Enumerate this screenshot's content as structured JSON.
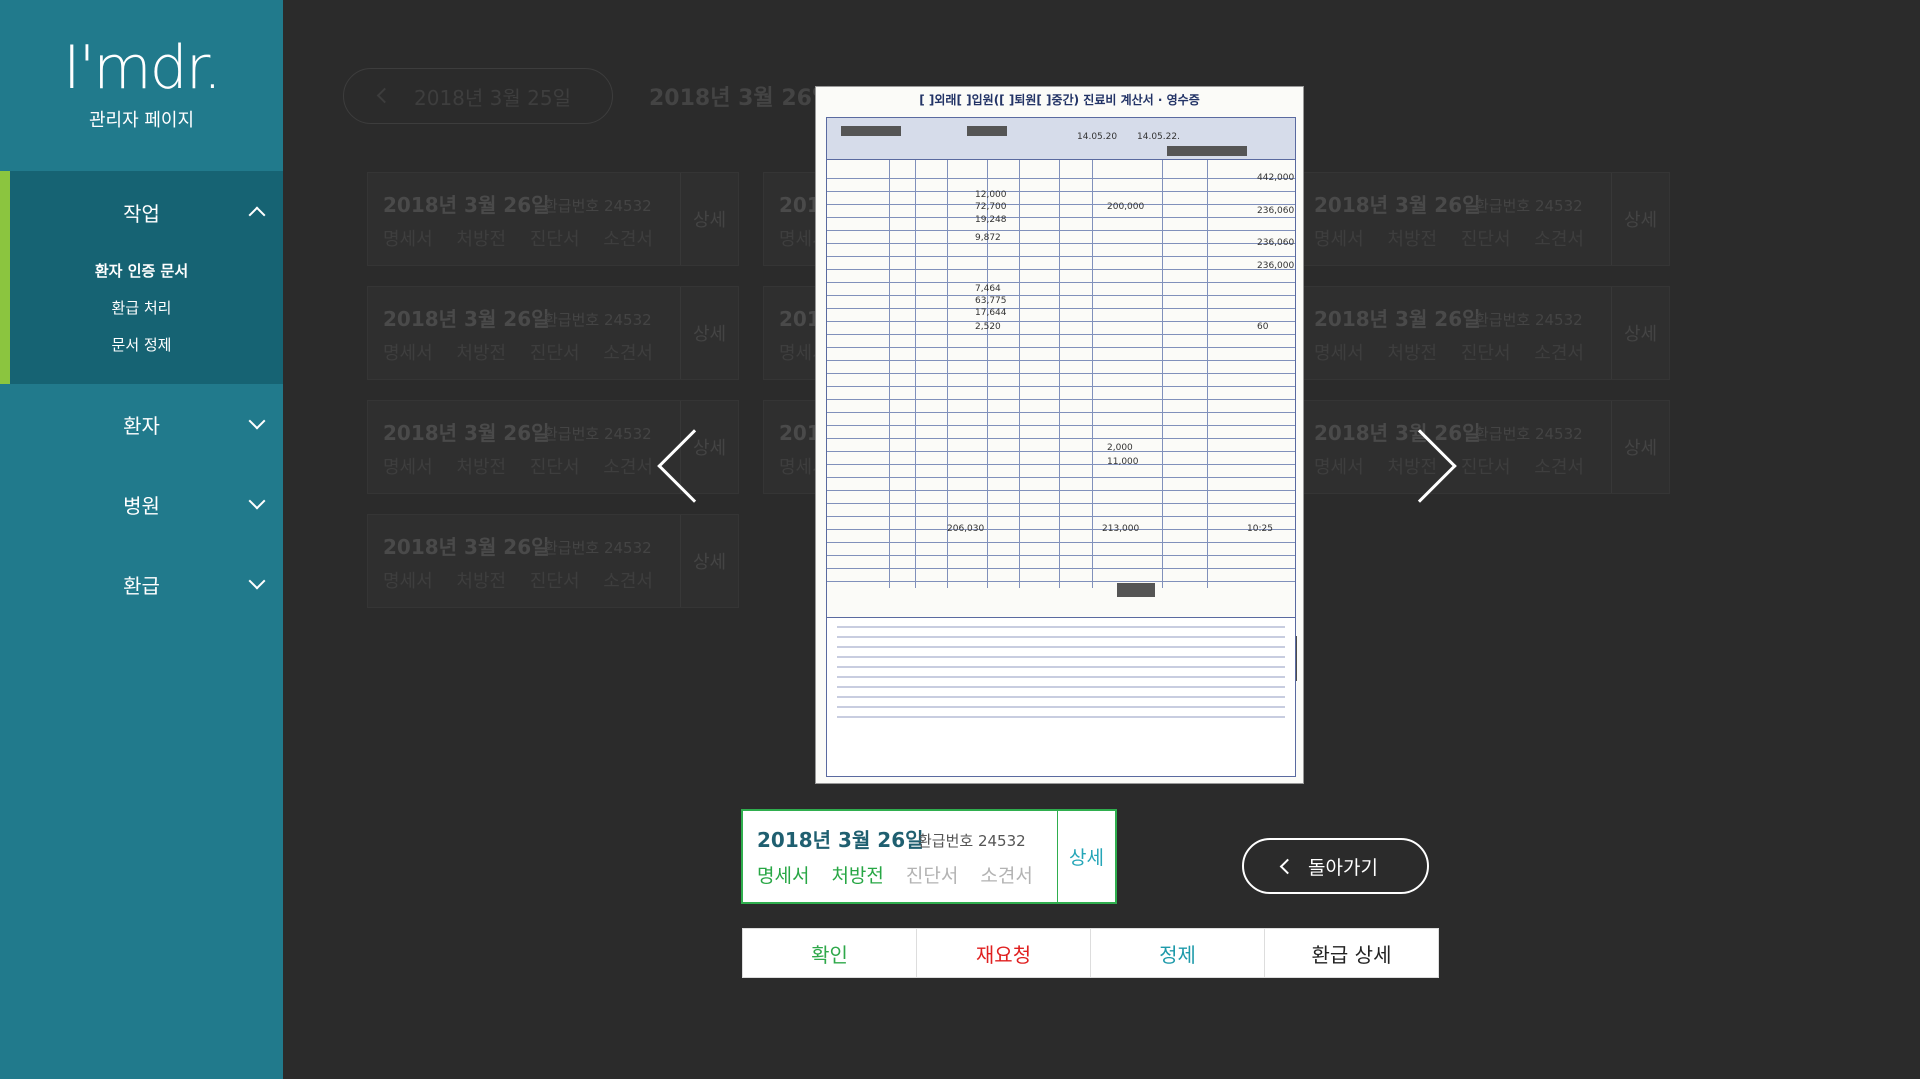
{
  "brand": {
    "logo": "I'mdr.",
    "subtitle": "관리자 페이지"
  },
  "sidebar": {
    "menus": [
      {
        "label": "작업",
        "expanded": true,
        "items": [
          "환자 인증 문서",
          "환급 처리",
          "문서 정제"
        ],
        "current": "환자 인증 문서"
      },
      {
        "label": "환자",
        "expanded": false
      },
      {
        "label": "병원",
        "expanded": false
      },
      {
        "label": "환급",
        "expanded": false
      }
    ]
  },
  "background": {
    "date_pill": "2018년 3월 25일",
    "current_date": "2018년 3월 26일",
    "card": {
      "date": "2018년 3월 26일",
      "refund_number": "환급번호 24532",
      "docs": [
        "명세서",
        "처방전",
        "진단서",
        "소견서"
      ],
      "detail_label": "상세"
    }
  },
  "viewer": {
    "receipt_title": "[ ]외래[ ]입원([ ]퇴원[ ]중간) 진료비 계산서 · 영수증",
    "receipt_values": [
      "14.05.20",
      "14.05.22.",
      "442,000",
      "236,060",
      "236,060",
      "236,000",
      "12,000",
      "72,700",
      "19,248",
      "200,000",
      "9,872",
      "7,464",
      "63,775",
      "17,644",
      "2,520",
      "2,000",
      "11,000",
      "206,030",
      "213,000",
      "10:25",
      "60"
    ]
  },
  "info_card": {
    "date": "2018년 3월 26일",
    "refund_number": "환급번호 24532",
    "docs": [
      {
        "label": "명세서",
        "state": "available"
      },
      {
        "label": "처방전",
        "state": "available"
      },
      {
        "label": "진단서",
        "state": "missing"
      },
      {
        "label": "소견서",
        "state": "missing"
      }
    ],
    "detail_label": "상세"
  },
  "back_button": {
    "label": "돌아가기"
  },
  "actions": {
    "confirm": "확인",
    "rerequest": "재요청",
    "correct": "정제",
    "refund_detail": "환급 상세"
  },
  "colors": {
    "sidebar": "#217a8c",
    "active_menu": "#166373",
    "accent_green": "#2fae4e",
    "danger": "#e02020",
    "teal": "#1e9aaa"
  }
}
